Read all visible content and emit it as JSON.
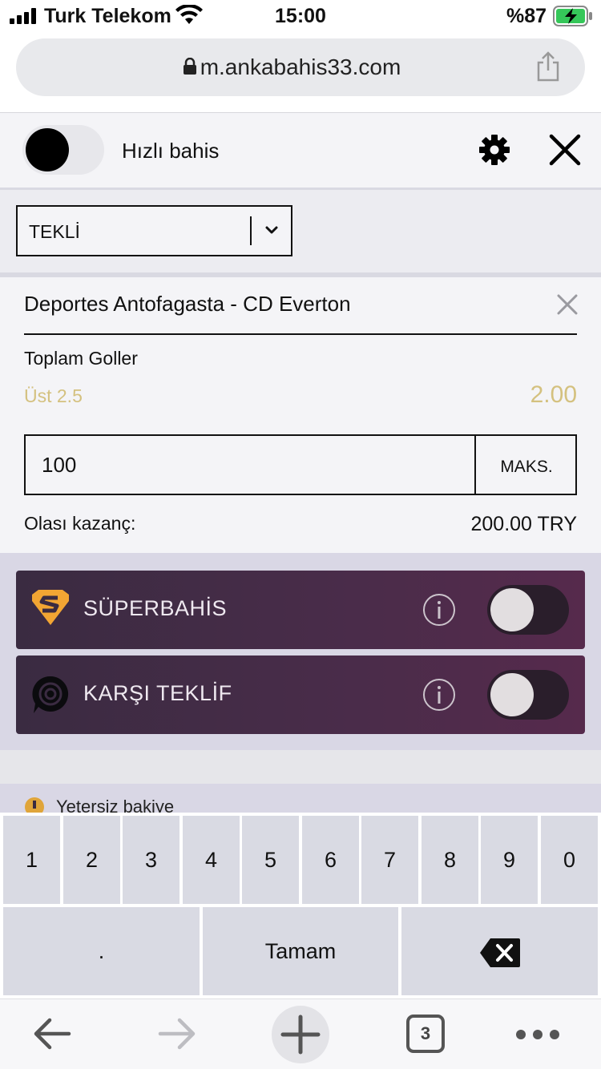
{
  "status_bar": {
    "carrier": "Turk Telekom",
    "time": "15:00",
    "battery_percent": "%87",
    "icons": [
      "signal-icon",
      "wifi-icon",
      "battery-charging-icon"
    ]
  },
  "browser": {
    "url": "m.ankabahis33.com",
    "icons": [
      "lock-icon",
      "share-icon"
    ]
  },
  "betslip_header": {
    "quick_bet_label": "Hızlı bahis",
    "quick_bet_on": true,
    "icons": [
      "gear-icon",
      "close-icon"
    ]
  },
  "bet_type_select": {
    "selected": "TEKLİ"
  },
  "bet": {
    "match": "Deportes Antofagasta - CD Everton",
    "market": "Toplam Goller",
    "selection": "Üst 2.5",
    "odds": "2.00",
    "stake": "100",
    "max_label": "MAKS.",
    "potential_win_label": "Olası kazanç:",
    "potential_win_value": "200.00 TRY"
  },
  "promos": [
    {
      "title": "SÜPERBAHİS",
      "icon": "superbahis-logo-icon",
      "enabled": false
    },
    {
      "title": "KARŞI TEKLİF",
      "icon": "karsi-teklif-logo-icon",
      "enabled": false
    }
  ],
  "warning": {
    "text": "Yetersiz bakiye",
    "icon": "warning-icon"
  },
  "keyboard": {
    "digits": [
      "1",
      "2",
      "3",
      "4",
      "5",
      "6",
      "7",
      "8",
      "9",
      "0"
    ],
    "dot": ".",
    "done": "Tamam",
    "backspace_icon": "backspace-icon"
  },
  "browser_nav": {
    "tab_count": "3",
    "icons": [
      "back-arrow-icon",
      "forward-arrow-icon",
      "new-tab-plus-icon",
      "tabs-icon",
      "more-icon"
    ]
  },
  "colors": {
    "odds_gold": "#d4c17f",
    "promo_bg": "#3a2b41",
    "promo_area_bg": "#d9d7e5",
    "key_bg": "#d9dae3"
  }
}
